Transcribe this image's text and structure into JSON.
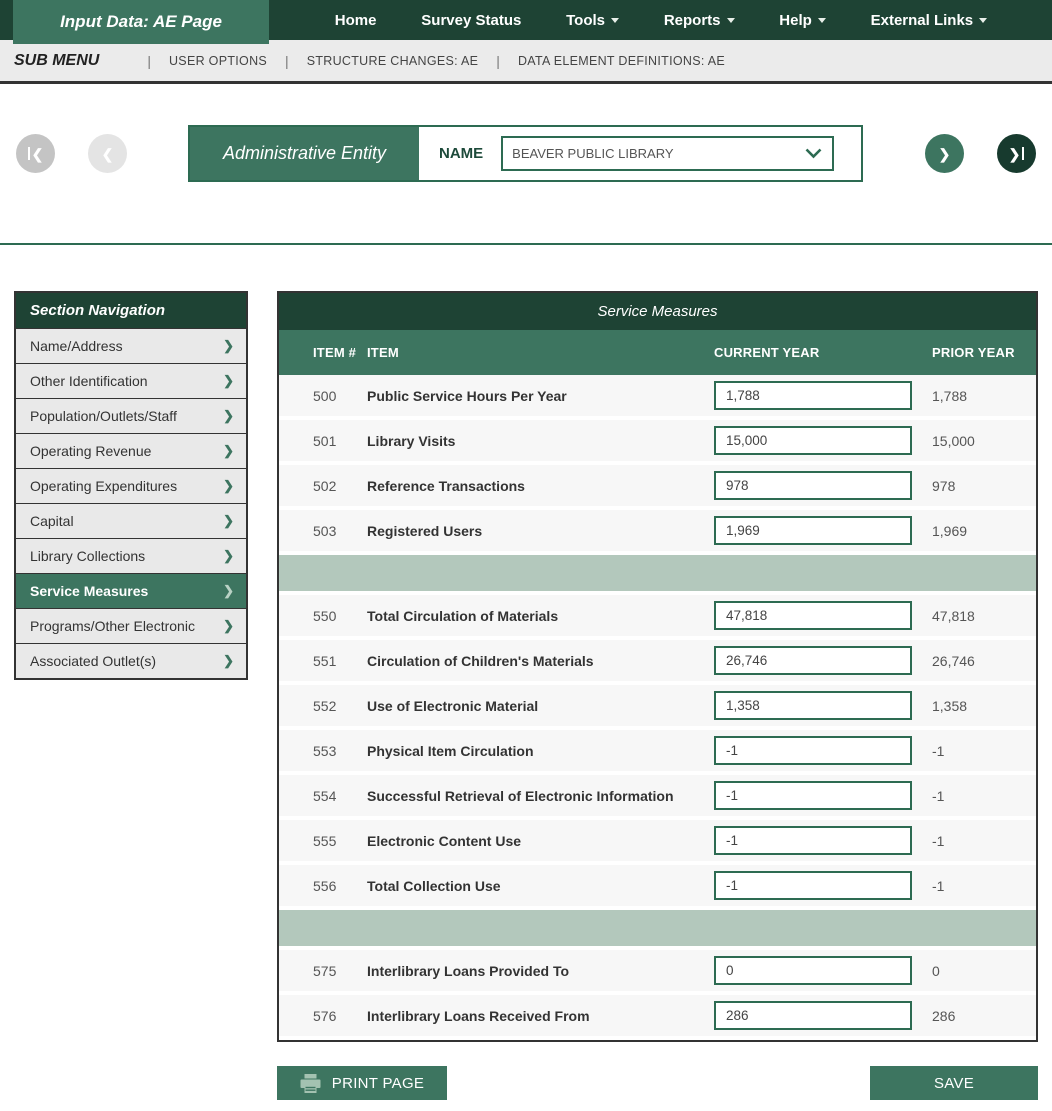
{
  "colors": {
    "dark_green": "#1e4334",
    "mid_green": "#3d7560",
    "border_green": "#2d6b52",
    "sage_spacer": "#b3c8bc",
    "circle_dark": "#173a2e"
  },
  "icons": {
    "chevron_right": "❯",
    "chevron_left": "❮"
  },
  "nav": {
    "active_tab": "Input Data: AE Page",
    "items": [
      {
        "label": "Home",
        "caret": false
      },
      {
        "label": "Survey Status",
        "caret": false
      },
      {
        "label": "Tools",
        "caret": true
      },
      {
        "label": "Reports",
        "caret": true
      },
      {
        "label": "Help",
        "caret": true
      },
      {
        "label": "External Links",
        "caret": true
      }
    ]
  },
  "submenu": {
    "title": "SUB MENU",
    "separator": "|",
    "links": [
      "USER OPTIONS",
      "STRUCTURE CHANGES: AE",
      "DATA ELEMENT DEFINITIONS: AE"
    ]
  },
  "entity_nav": {
    "title": "Administrative Entity",
    "name_label": "NAME",
    "selected_entity": "BEAVER PUBLIC LIBRARY"
  },
  "sidebar": {
    "title": "Section Navigation",
    "items": [
      {
        "label": "Name/Address",
        "active": false
      },
      {
        "label": "Other Identification",
        "active": false
      },
      {
        "label": "Population/Outlets/Staff",
        "active": false
      },
      {
        "label": "Operating Revenue",
        "active": false
      },
      {
        "label": "Operating Expenditures",
        "active": false
      },
      {
        "label": "Capital",
        "active": false
      },
      {
        "label": "Library Collections",
        "active": false
      },
      {
        "label": "Service Measures",
        "active": true
      },
      {
        "label": "Programs/Other Electronic",
        "active": false
      },
      {
        "label": "Associated Outlet(s)",
        "active": false
      }
    ]
  },
  "table": {
    "title": "Service Measures",
    "headers": {
      "item_no": "ITEM #",
      "item": "ITEM",
      "current": "CURRENT YEAR",
      "prior": "PRIOR YEAR"
    },
    "rows": [
      {
        "item_no": "500",
        "item": "Public Service Hours Per Year",
        "current": "1,788",
        "prior": "1,788"
      },
      {
        "item_no": "501",
        "item": "Library Visits",
        "current": "15,000",
        "prior": "15,000"
      },
      {
        "item_no": "502",
        "item": "Reference Transactions",
        "current": "978",
        "prior": "978"
      },
      {
        "item_no": "503",
        "item": "Registered Users",
        "current": "1,969",
        "prior": "1,969"
      },
      {
        "spacer": true
      },
      {
        "item_no": "550",
        "item": "Total Circulation of Materials",
        "current": "47,818",
        "prior": "47,818"
      },
      {
        "item_no": "551",
        "item": "Circulation of Children's Materials",
        "current": "26,746",
        "prior": "26,746"
      },
      {
        "item_no": "552",
        "item": "Use of Electronic Material",
        "current": "1,358",
        "prior": "1,358"
      },
      {
        "item_no": "553",
        "item": "Physical Item Circulation",
        "current": "-1",
        "prior": "-1"
      },
      {
        "item_no": "554",
        "item": "Successful Retrieval of Electronic Information",
        "current": "-1",
        "prior": "-1"
      },
      {
        "item_no": "555",
        "item": "Electronic Content Use",
        "current": "-1",
        "prior": "-1"
      },
      {
        "item_no": "556",
        "item": "Total Collection Use",
        "current": "-1",
        "prior": "-1"
      },
      {
        "spacer": true
      },
      {
        "item_no": "575",
        "item": "Interlibrary Loans Provided To",
        "current": "0",
        "prior": "0"
      },
      {
        "item_no": "576",
        "item": "Interlibrary Loans Received From",
        "current": "286",
        "prior": "286"
      }
    ]
  },
  "buttons": {
    "print": "PRINT PAGE",
    "save": "SAVE"
  }
}
